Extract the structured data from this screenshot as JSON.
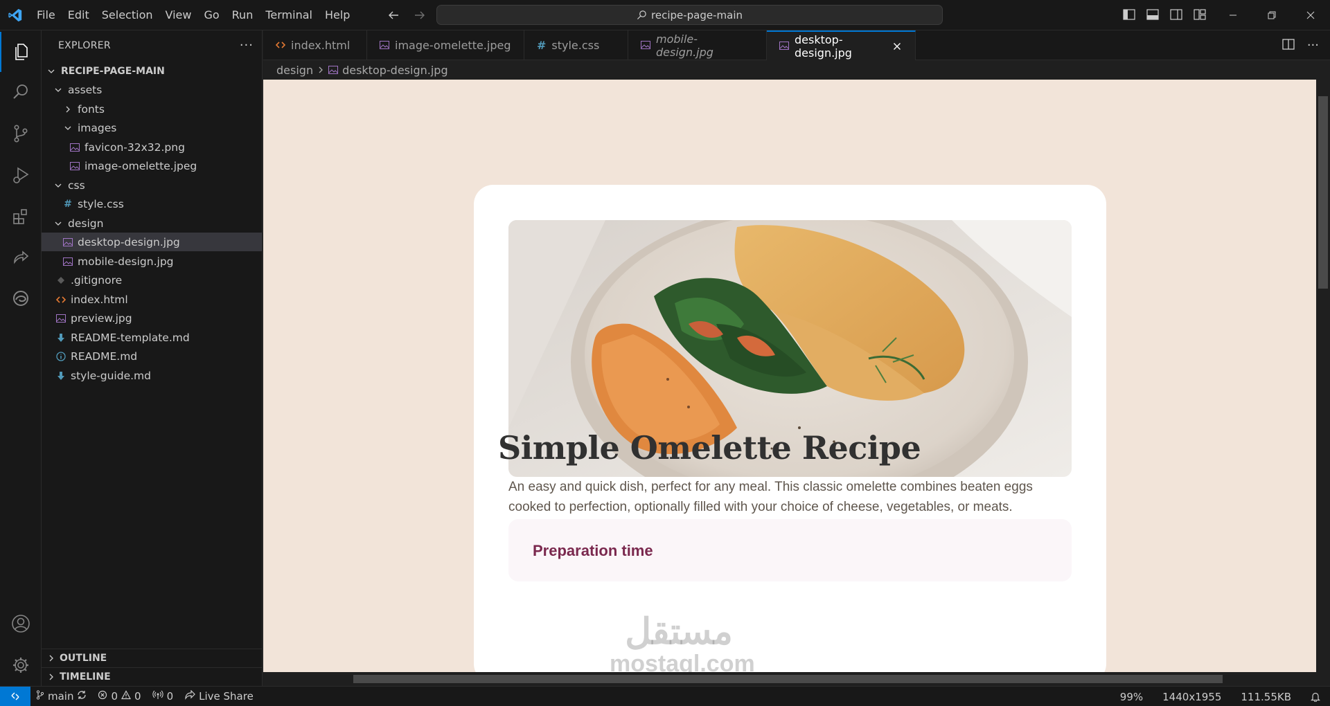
{
  "titlebar": {
    "menu": [
      "File",
      "Edit",
      "Selection",
      "View",
      "Go",
      "Run",
      "Terminal",
      "Help"
    ],
    "search_text": "recipe-page-main"
  },
  "sidebar": {
    "title": "EXPLORER",
    "root": "RECIPE-PAGE-MAIN",
    "items": [
      {
        "label": "assets",
        "type": "folder-open",
        "depth": 1
      },
      {
        "label": "fonts",
        "type": "folder-closed",
        "depth": 2
      },
      {
        "label": "images",
        "type": "folder-open",
        "depth": 2
      },
      {
        "label": "favicon-32x32.png",
        "type": "image",
        "depth": 3
      },
      {
        "label": "image-omelette.jpeg",
        "type": "image",
        "depth": 3
      },
      {
        "label": "css",
        "type": "folder-open",
        "depth": 1
      },
      {
        "label": "style.css",
        "type": "css",
        "depth": 2
      },
      {
        "label": "design",
        "type": "folder-open",
        "depth": 1
      },
      {
        "label": "desktop-design.jpg",
        "type": "image",
        "depth": 2
      },
      {
        "label": "mobile-design.jpg",
        "type": "image",
        "depth": 2
      },
      {
        "label": ".gitignore",
        "type": "git",
        "depth": 1
      },
      {
        "label": "index.html",
        "type": "html",
        "depth": 1
      },
      {
        "label": "preview.jpg",
        "type": "image",
        "depth": 1
      },
      {
        "label": "README-template.md",
        "type": "markdown",
        "depth": 1
      },
      {
        "label": "README.md",
        "type": "info",
        "depth": 1
      },
      {
        "label": "style-guide.md",
        "type": "markdown",
        "depth": 1
      }
    ],
    "outline": "OUTLINE",
    "timeline": "TIMELINE"
  },
  "tabs": [
    {
      "label": "index.html",
      "type": "html"
    },
    {
      "label": "image-omelette.jpeg",
      "type": "image"
    },
    {
      "label": "style.css",
      "type": "css"
    },
    {
      "label": "mobile-design.jpg",
      "type": "image"
    },
    {
      "label": "desktop-design.jpg",
      "type": "image"
    }
  ],
  "breadcrumb": {
    "folder": "design",
    "file": "desktop-design.jpg"
  },
  "preview": {
    "title": "Simple Omelette Recipe",
    "description": "An easy and quick dish, perfect for any meal. This classic omelette combines beaten eggs cooked to perfection, optionally filled with your choice of cheese, vegetables, or meats.",
    "prep_title": "Preparation time",
    "watermark_arabic": "مستقل",
    "watermark_latin": "mostaql.com"
  },
  "statusbar": {
    "branch": "main",
    "errors": "0",
    "warnings": "0",
    "ports": "0",
    "live_share": "Live Share",
    "zoom": "99%",
    "dimensions": "1440x1955",
    "size": "111.55KB"
  },
  "colors": {
    "accent": "#0078d4",
    "viewer_bg": "#f2e4d9",
    "recipe_title": "#313131",
    "prep_title": "#7a284e",
    "html_icon": "#e37933",
    "css_icon": "#519aba",
    "image_icon": "#a074c4",
    "markdown_icon": "#519aba"
  }
}
